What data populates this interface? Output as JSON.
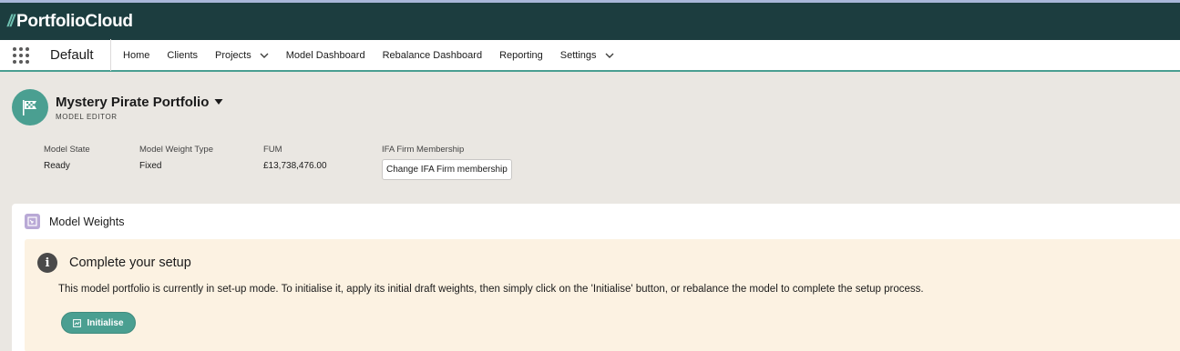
{
  "brand": {
    "slashes": "//",
    "name": "PortfolioCloud"
  },
  "nav": {
    "app_name": "Default",
    "items": [
      {
        "label": "Home",
        "has_menu": false
      },
      {
        "label": "Clients",
        "has_menu": false
      },
      {
        "label": "Projects",
        "has_menu": true
      },
      {
        "label": "Model Dashboard",
        "has_menu": false
      },
      {
        "label": "Rebalance Dashboard",
        "has_menu": false
      },
      {
        "label": "Reporting",
        "has_menu": false
      },
      {
        "label": "Settings",
        "has_menu": true
      }
    ]
  },
  "record": {
    "title": "Mystery Pirate Portfolio",
    "subtitle": "MODEL EDITOR",
    "icon": "flag-icon",
    "fields": [
      {
        "label": "Model State",
        "value": "Ready"
      },
      {
        "label": "Model Weight Type",
        "value": "Fixed"
      },
      {
        "label": "FUM",
        "value": "£13,738,476.00"
      },
      {
        "label": "IFA Firm Membership",
        "button": "Change IFA Firm membership"
      }
    ]
  },
  "card": {
    "title": "Model Weights",
    "notice": {
      "title": "Complete your setup",
      "text": "This model portfolio is currently in set-up mode. To initialise it, apply its initial draft weights, then simply click on the 'Initialise' button, or rebalance the model to complete the setup process.",
      "button": "Initialise"
    }
  },
  "colors": {
    "brand_bar": "#1c3d3f",
    "accent": "#4a9f91",
    "page_bg": "#eae7e2",
    "notice_bg": "#fcf2e2"
  }
}
